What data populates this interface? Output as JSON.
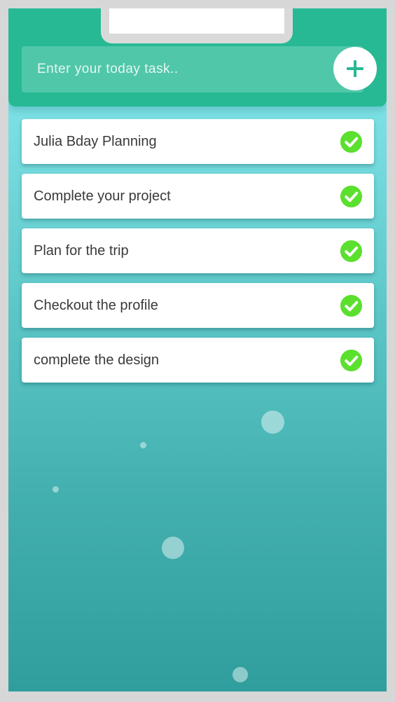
{
  "input": {
    "placeholder": "Enter your today task.."
  },
  "add_button": {
    "icon": "plus-icon"
  },
  "tasks": [
    {
      "label": "Julia Bday Planning",
      "completed": true
    },
    {
      "label": "Complete your project",
      "completed": true
    },
    {
      "label": "Plan for the trip",
      "completed": true
    },
    {
      "label": "Checkout the profile",
      "completed": true
    },
    {
      "label": "complete the design",
      "completed": true
    }
  ],
  "colors": {
    "header": "#26b994",
    "accent": "#26b994",
    "check": "#5ae02d",
    "background_top": "#9ff0f2",
    "background_bottom": "#2f9e9c"
  }
}
